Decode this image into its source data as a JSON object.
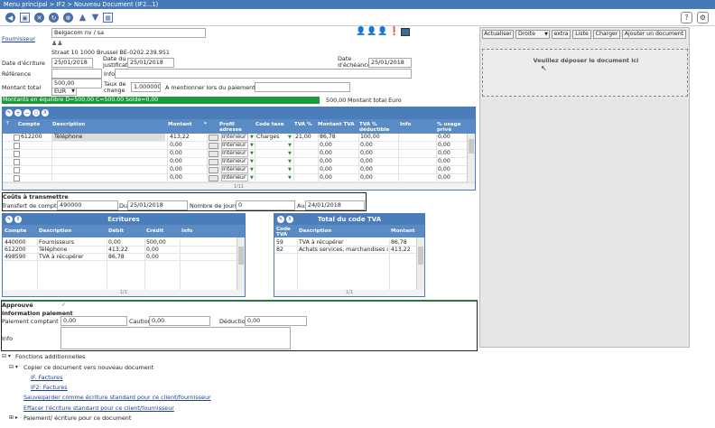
{
  "breadcrumb": "Menu principal  >  IF2  >  Nouveau Document (IF2...1)",
  "supplier": {
    "label": "Fournisseur",
    "value": "Belgacom nv / sa",
    "address": "Straat 10 1000 Brussel BE-0202.239.951"
  },
  "fields": {
    "date_ecriture_label": "Date d'écriture",
    "date_ecriture": "25/01/2018",
    "date_justificatif_label1": "Date du",
    "date_justificatif_label2": "justificatif",
    "date_justificatif": "25/01/2018",
    "date_echeance_label1": "Date",
    "date_echeance_label2": "d'échéance",
    "date_echeance": "25/01/2018",
    "reference_label": "Référence",
    "info_label": "Info",
    "montant_total_label": "Montant total",
    "montant_total": "500,00",
    "currency": "EUR",
    "taux_label1": "Taux de",
    "taux_label2": "change",
    "taux": "1,000000",
    "mentionner_label": "A mentionner lors du paiement."
  },
  "balance": {
    "text": "Montants en équilibre D=500,00 C=500,00 Solde=0,00",
    "total": "500,00",
    "total_label": "Montant total Euro"
  },
  "lines": {
    "headers": {
      "compte": "Compte",
      "description": "Description",
      "montant": "Montant",
      "profil1": "Profil",
      "profil2": "adresse",
      "code_taxe": "Code taxe",
      "tva": "TVA %",
      "montant_tva": "Montant TVA",
      "tva_ded1": "TVA %",
      "tva_ded2": "déductible",
      "info": "Info",
      "usage1": "% usage",
      "usage2": "privé"
    },
    "rows": [
      {
        "compte": "612200",
        "description": "Téléphone",
        "montant": "413,22",
        "profil": "Interieur",
        "code_taxe": "Charges",
        "tva": "21,00",
        "montant_tva": "86,78",
        "tva_ded": "100,00",
        "usage": "0,00"
      },
      {
        "compte": "",
        "description": "",
        "montant": "0,00",
        "profil": "Interieur",
        "code_taxe": "",
        "tva": "",
        "montant_tva": "0,00",
        "tva_ded": "0,00",
        "usage": "0,00"
      },
      {
        "compte": "",
        "description": "",
        "montant": "0,00",
        "profil": "Interieur",
        "code_taxe": "",
        "tva": "",
        "montant_tva": "0,00",
        "tva_ded": "0,00",
        "usage": "0,00"
      },
      {
        "compte": "",
        "description": "",
        "montant": "0,00",
        "profil": "Interieur",
        "code_taxe": "",
        "tva": "",
        "montant_tva": "0,00",
        "tva_ded": "0,00",
        "usage": "0,00"
      },
      {
        "compte": "",
        "description": "",
        "montant": "0,00",
        "profil": "Interieur",
        "code_taxe": "",
        "tva": "",
        "montant_tva": "0,00",
        "tva_ded": "0,00",
        "usage": "0,00"
      },
      {
        "compte": "",
        "description": "",
        "montant": "0,00",
        "profil": "Interieur",
        "code_taxe": "",
        "tva": "",
        "montant_tva": "0,00",
        "tva_ded": "0,00",
        "usage": "0,00"
      }
    ],
    "footer": "1/11"
  },
  "couts": {
    "title": "Coûts à transmettre",
    "transfert_label": "Transfert de compte",
    "transfert": "490000",
    "du_label": "Du",
    "du": "25/01/2018",
    "jours_label": "Nombre de jours",
    "jours": "0",
    "au_label": "Au",
    "au": "24/01/2018"
  },
  "ecritures": {
    "title": "Ecritures",
    "headers": {
      "compte": "Compte",
      "description": "Description",
      "debit": "Débit",
      "credit": "Crédit",
      "info": "Info"
    },
    "rows": [
      {
        "compte": "440000",
        "description": "Fournisseurs",
        "debit": "0,00",
        "credit": "500,00"
      },
      {
        "compte": "612200",
        "description": "Téléphone",
        "debit": "413,22",
        "credit": "0,00"
      },
      {
        "compte": "498590",
        "description": "TVA à récupérer",
        "debit": "86,78",
        "credit": "0,00"
      }
    ],
    "footer": "1/1"
  },
  "tva_total": {
    "title": "Total du code TVA",
    "headers": {
      "code1": "Code",
      "code2": "TVA",
      "description": "Description",
      "montant": "Montant"
    },
    "rows": [
      {
        "code": "59",
        "description": "TVA à récupérer",
        "montant": "86,78"
      },
      {
        "code": "82",
        "description": "Achats services, marchandises div",
        "montant": "413,22"
      }
    ],
    "footer": "1/1"
  },
  "approval": {
    "approuve": "Approuvé",
    "info_paiement": "Information paiement",
    "paiement_label": "Paiement comptant",
    "paiement": "0,00",
    "caution_label": "Caution",
    "caution": "0,00",
    "deduction_label": "Déduction",
    "deduction": "0,00",
    "info_label": "Info"
  },
  "right_panel": {
    "actualiser": "Actualiser",
    "droite": "Droite",
    "extra": "extra",
    "liste": "Liste",
    "charger": "Charger",
    "ajouter": "Ajouter un document",
    "drop": "Veuillez déposer le document ici"
  },
  "functions": {
    "title": "Fonctions additionnelles",
    "copier": "Copier ce document vers nouveau document",
    "if_factures": "IF. Factures",
    "if2_factures": "IF2: Factures",
    "sauvegarder": "Sauvegarder comme écriture standard pour ce client/fournisseur",
    "effacer": "Effacer l'écriture standard pour ce client/fournisseur",
    "paiement": "Paiement/ écriture pour ce document"
  }
}
